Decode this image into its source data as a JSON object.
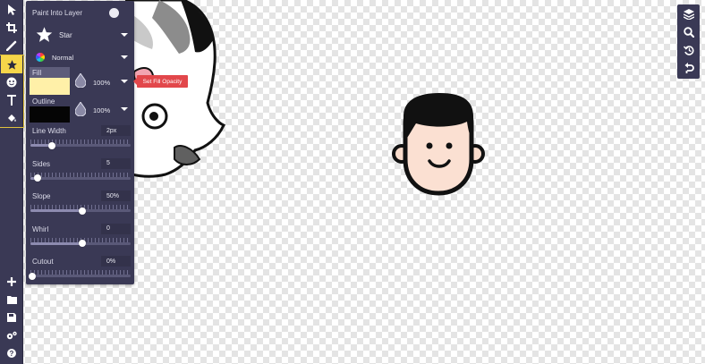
{
  "panel": {
    "paint_into_layer": "Paint Into Layer",
    "shape_value": "Star",
    "blend_mode": "Normal",
    "fill_label": "Fill",
    "fill_opacity": "100%",
    "fill_color": "#fff0a8",
    "outline_label": "Outline",
    "outline_opacity": "100%",
    "outline_color": "#050505",
    "sliders": [
      {
        "label": "Line Width",
        "value": "2px",
        "level": 0.2
      },
      {
        "label": "Sides",
        "value": "5",
        "level": 0.05
      },
      {
        "label": "Slope",
        "value": "50%",
        "level": 0.5
      },
      {
        "label": "Whirl",
        "value": "0",
        "level": 0.5
      },
      {
        "label": "Cutout",
        "value": "0%",
        "level": 0.0
      }
    ]
  },
  "tooltip": "Set Fill Opacity",
  "left_tools": [
    "select-arrow-icon",
    "crop-icon",
    "brush-icon",
    "star-icon",
    "sticker-face-icon",
    "text-icon",
    "fill-bucket-icon"
  ],
  "left_bottom_tools": [
    "add-icon",
    "folder-icon",
    "save-icon",
    "settings-icon",
    "help-icon"
  ],
  "right_tools": [
    "layers-icon",
    "zoom-icon",
    "history-icon",
    "undo-icon"
  ],
  "colors": {
    "toolbar": "#3a3955",
    "active_tool": "#f6d64a",
    "tooltip": "#e2474b"
  }
}
